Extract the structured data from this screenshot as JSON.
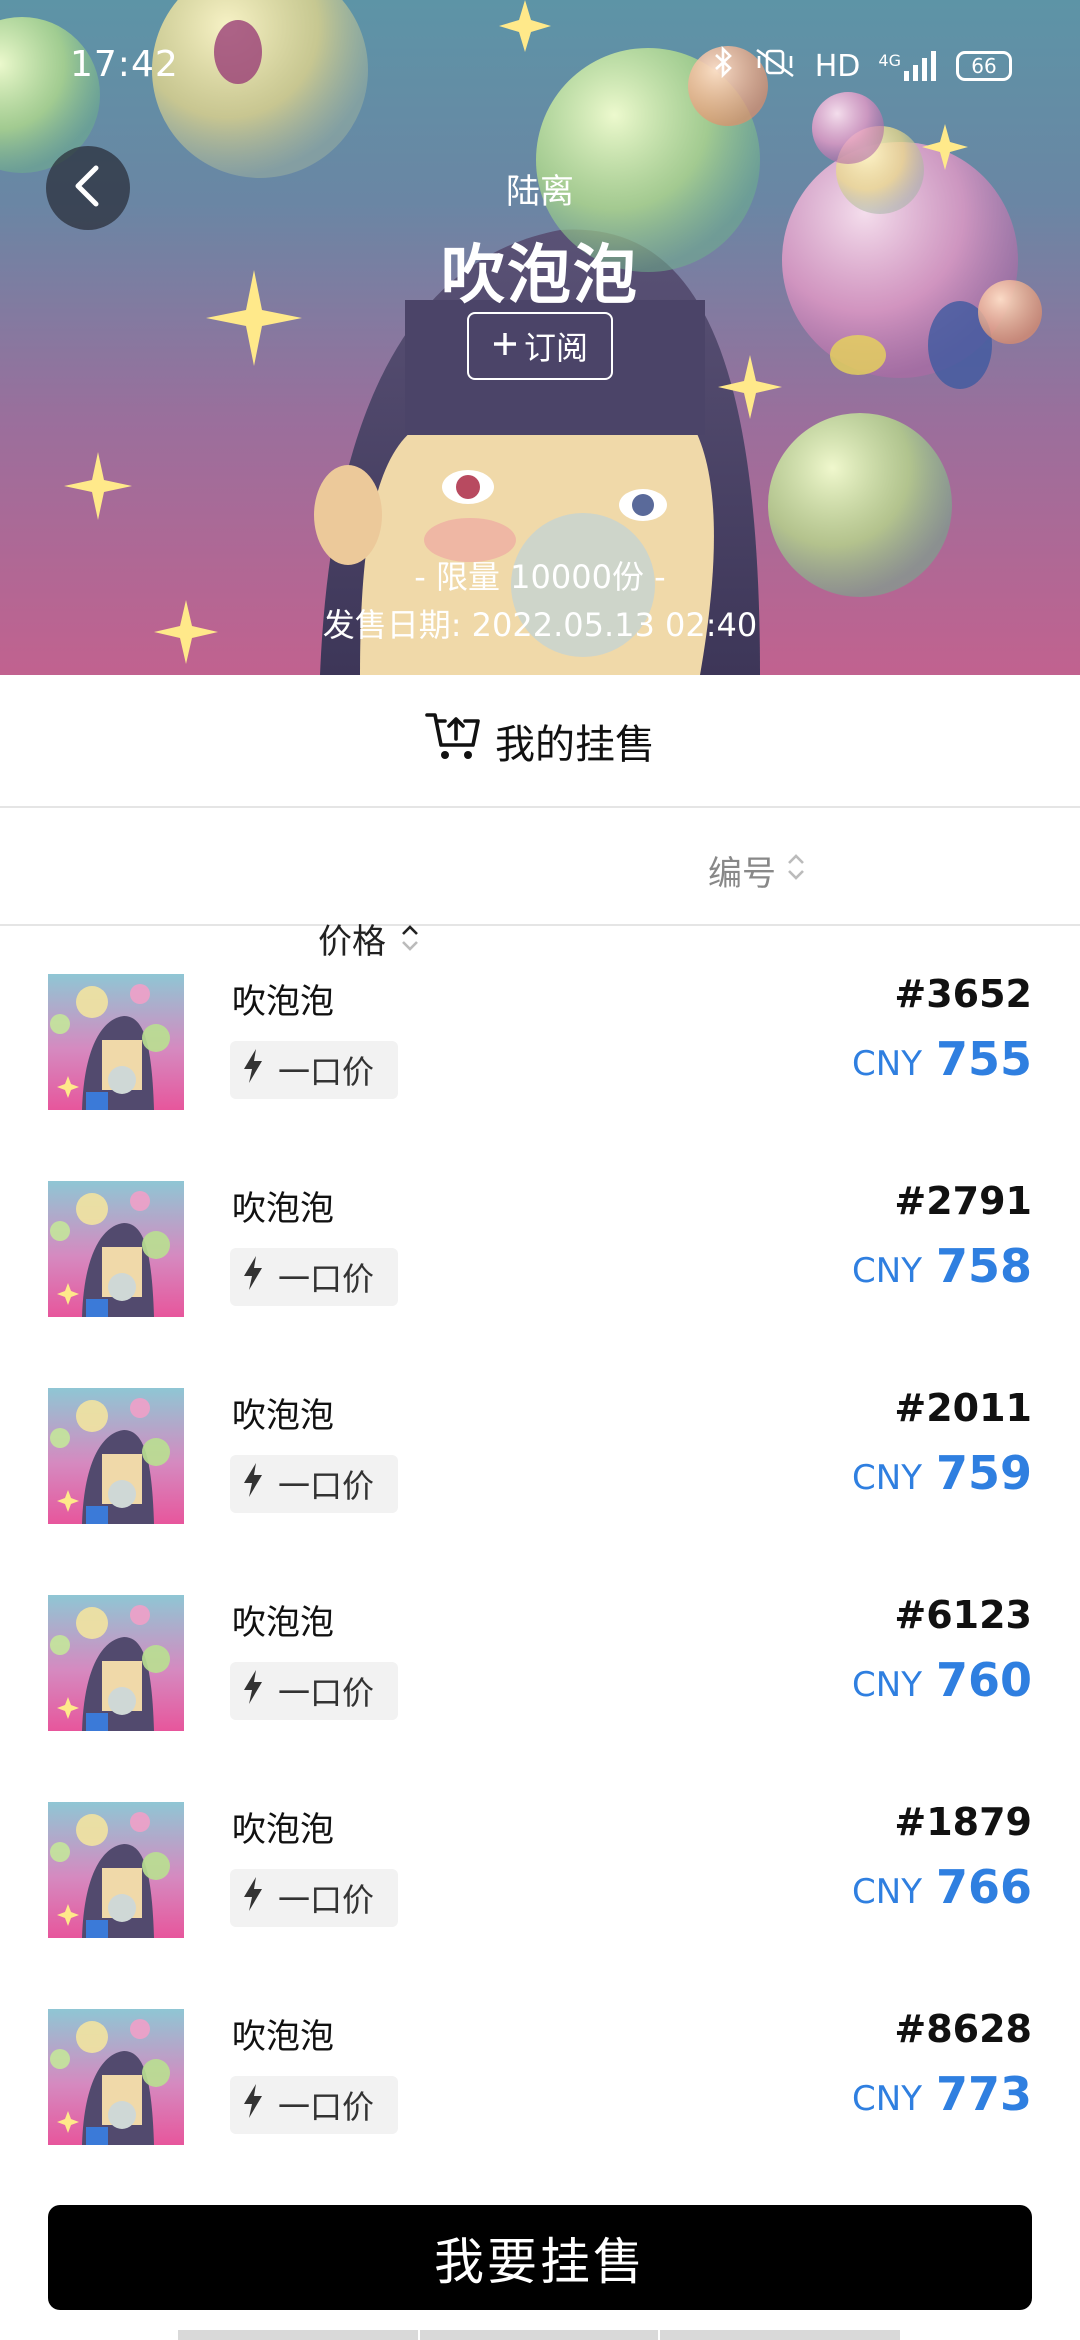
{
  "status_bar": {
    "time": "17:42",
    "network": "HD",
    "signal": "4G",
    "battery": "66"
  },
  "header": {
    "artist": "陆离",
    "title": "吹泡泡",
    "subscribe_label": "订阅",
    "limit_text": "- 限量 10000份 -",
    "sale_date": "发售日期: 2022.05.13 02:40"
  },
  "my_listings_label": "我的挂售",
  "sort": {
    "price_label": "价格",
    "number_label": "编号"
  },
  "listings": [
    {
      "name": "吹泡泡",
      "tag": "一口价",
      "serial": "#3652",
      "currency": "CNY",
      "price": "755"
    },
    {
      "name": "吹泡泡",
      "tag": "一口价",
      "serial": "#2791",
      "currency": "CNY",
      "price": "758"
    },
    {
      "name": "吹泡泡",
      "tag": "一口价",
      "serial": "#2011",
      "currency": "CNY",
      "price": "759"
    },
    {
      "name": "吹泡泡",
      "tag": "一口价",
      "serial": "#6123",
      "currency": "CNY",
      "price": "760"
    },
    {
      "name": "吹泡泡",
      "tag": "一口价",
      "serial": "#1879",
      "currency": "CNY",
      "price": "766"
    },
    {
      "name": "吹泡泡",
      "tag": "一口价",
      "serial": "#8628",
      "currency": "CNY",
      "price": "773"
    }
  ],
  "sell_button_label": "我要挂售",
  "colors": {
    "price_blue": "#2f7fe0",
    "button_black": "#000000"
  }
}
